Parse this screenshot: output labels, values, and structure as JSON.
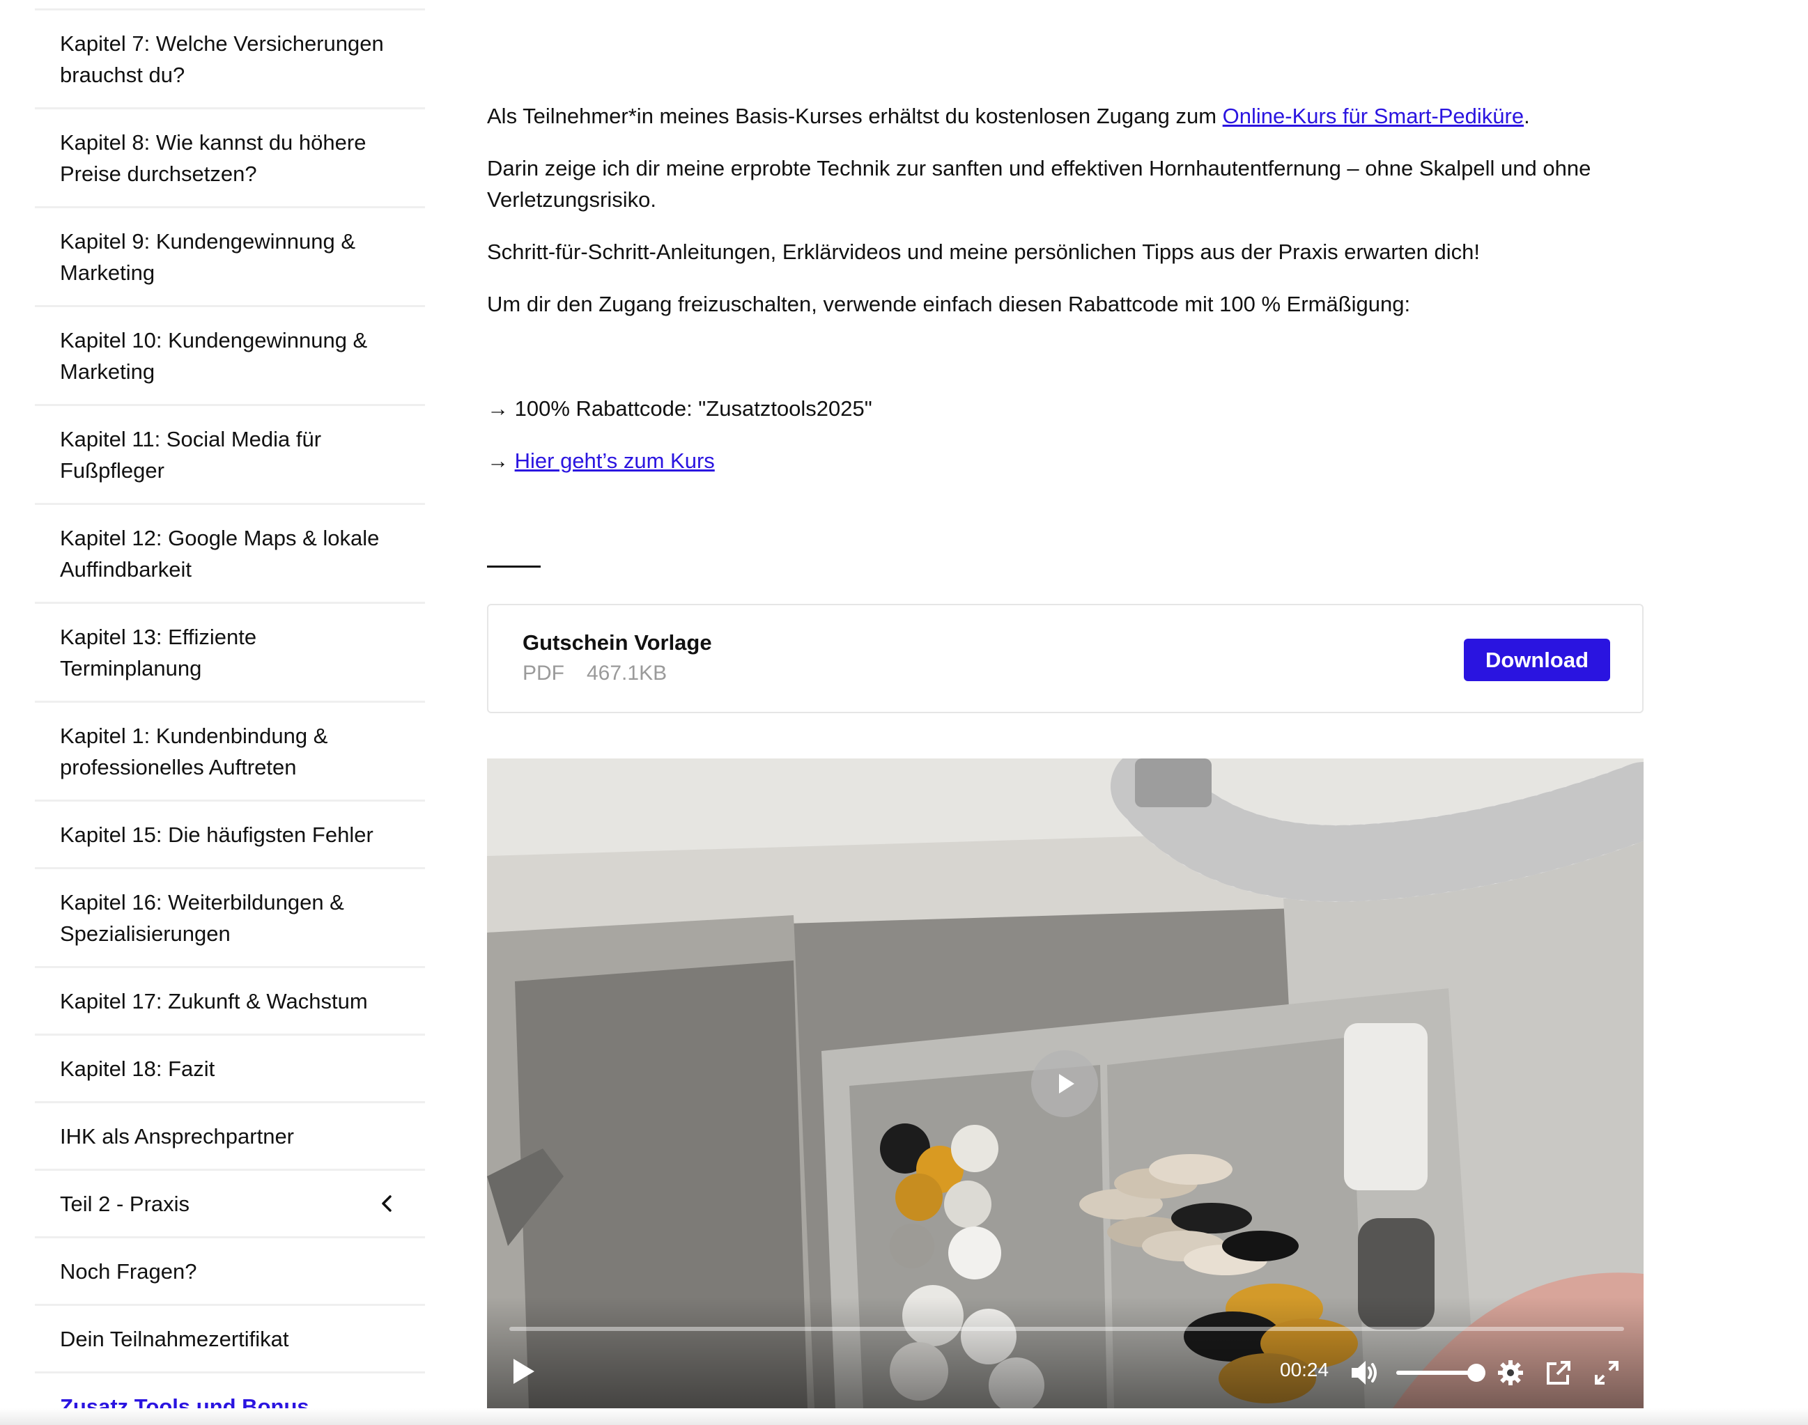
{
  "sidebar": {
    "items": [
      {
        "label": "Kapitel 7: Welche Versicherungen brauchst du?",
        "size": "h2"
      },
      {
        "label": "Kapitel 8: Wie kannst du höhere Preise durchsetzen?",
        "size": "h2"
      },
      {
        "label": "Kapitel 9: Kundengewinnung & Marketing",
        "size": "h2"
      },
      {
        "label": "Kapitel 10: Kundengewinnung & Marketing",
        "size": "h2"
      },
      {
        "label": "Kapitel 11: Social Media für Fußpfleger",
        "size": "h2"
      },
      {
        "label": "Kapitel 12: Google Maps & lokale Auffindbarkeit",
        "size": "h2"
      },
      {
        "label": "Kapitel 13: Effiziente Terminplanung",
        "size": "h2"
      },
      {
        "label": "Kapitel 1: Kundenbindung & professionelles Auftreten",
        "size": "h2"
      },
      {
        "label": "Kapitel 15: Die häufigsten Fehler",
        "size": "h1"
      },
      {
        "label": "Kapitel 16: Weiterbildungen & Spezialisierungen",
        "size": "h2"
      },
      {
        "label": "Kapitel 17: Zukunft & Wachstum",
        "size": "h1"
      },
      {
        "label": "Kapitel 18: Fazit",
        "size": "h1"
      },
      {
        "label": "IHK als Ansprechpartner",
        "size": "h1"
      },
      {
        "label": "Teil 2 - Praxis",
        "size": "h1",
        "icon": "chevron-left-icon"
      },
      {
        "label": "Noch Fragen?",
        "size": "h1"
      },
      {
        "label": "Dein Teilnahmezertifikat",
        "size": "h1"
      },
      {
        "label": "Zusatz Tools und Bonus",
        "size": "h1",
        "active": true
      }
    ]
  },
  "content": {
    "intro_prefix": "Als Teilnehmer*in meines Basis-Kurses erhältst du kostenlosen Zugang zum ",
    "intro_link": "Online-Kurs für Smart-Pediküre",
    "intro_suffix": ".",
    "paragraph_2": "Darin zeige ich dir meine erprobte Technik zur sanften und effektiven Hornhautentfernung – ohne Skalpell und ohne Verletzungsrisiko.",
    "paragraph_3": "Schritt-für-Schritt-Anleitungen, Erklärvideos und meine persönlichen Tipps aus der Praxis erwarten dich!",
    "paragraph_4": "Um dir den Zugang freizuschalten, verwende einfach diesen Rabattcode mit 100 % Ermäßigung:",
    "code_line": "→ 100% Rabattcode: \"Zusatztools2025\"",
    "course_arrow": "→ ",
    "course_link": "Hier geht’s zum Kurs"
  },
  "file_card": {
    "title": "Gutschein Vorlage",
    "type": "PDF",
    "size": "467.1KB",
    "download_label": "Download"
  },
  "video": {
    "time": "00:24",
    "progress_fraction": 0.0,
    "volume_fraction": 1.0,
    "icons": [
      "play-icon",
      "volume-icon",
      "settings-gear-icon",
      "external-link-icon",
      "fullscreen-icon"
    ]
  },
  "colors": {
    "accent": "#2a14e0",
    "text": "#111111",
    "muted": "#9a9a9a",
    "divider": "#efefef"
  }
}
